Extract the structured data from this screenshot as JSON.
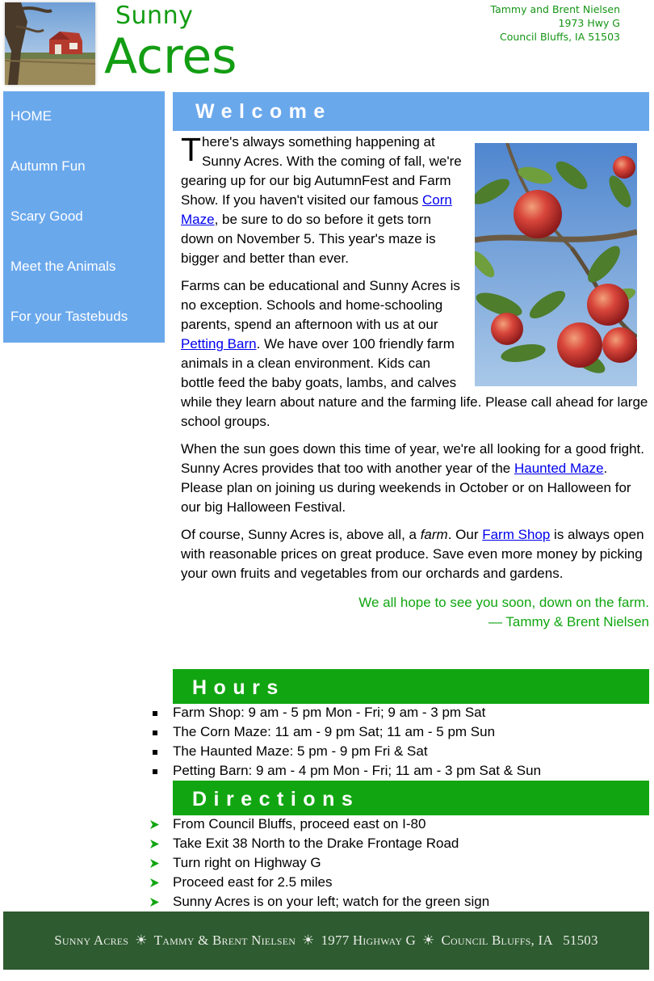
{
  "header": {
    "title_line1": "Sunny",
    "title_line2": "Acres",
    "address": [
      "Tammy and Brent Nielsen",
      "1973 Hwy G",
      "Council Bluffs, IA  51503"
    ]
  },
  "nav": [
    {
      "label": "HOME"
    },
    {
      "label": "Autumn Fun"
    },
    {
      "label": "Scary Good"
    },
    {
      "label": "Meet the Animals"
    },
    {
      "label": "For your Tastebuds"
    }
  ],
  "welcome": {
    "heading": "Welcome",
    "p1": {
      "dropcap": "T",
      "before": "here's always something happening at Sunny Acres. With the coming of fall, we're gearing up for our big AutumnFest and Farm Show. If you haven't visited our famous ",
      "link": "Corn Maze",
      "after": ", be sure to do so before it gets torn down on November 5. This year's maze is bigger and better than ever."
    },
    "p2": {
      "before": "Farms can be educational and Sunny Acres is no exception. Schools and home-schooling parents, spend an afternoon with us at our ",
      "link": "Petting Barn",
      "after": ". We have over 100 friendly farm animals in a clean environment. Kids can bottle feed the baby goats, lambs, and calves while they learn about nature and the farming life. Please call ahead for large school groups."
    },
    "p3": {
      "before": "When the sun goes down this time of year, we're all looking for a good fright. Sunny Acres provides that too with another year of the ",
      "link": "Haunted Maze",
      "after": ". Please plan on joining us during weekends in October or on Halloween for our big Halloween Festival."
    },
    "p4": {
      "before": "Of course, Sunny Acres is, above all, a ",
      "emph": "farm",
      "middle": ". Our ",
      "link": "Farm Shop",
      "after": " is always open with reasonable prices on great produce. Save even more money by picking your own fruits and vegetables from our orchards and gardens."
    },
    "signoff_line1": "We all hope to see you soon, down on the farm.",
    "signoff_line2": "— Tammy & Brent Nielsen"
  },
  "hours": {
    "heading": "Hours",
    "items": [
      "Farm Shop: 9 am - 5 pm Mon - Fri; 9 am - 3 pm Sat",
      "The Corn Maze: 11 am - 9 pm Sat; 11 am - 5 pm Sun",
      "The Haunted Maze: 5 pm - 9 pm Fri & Sat",
      "Petting Barn: 9 am - 4 pm Mon - Fri; 11 am - 3 pm Sat & Sun"
    ]
  },
  "directions": {
    "heading": "Directions",
    "items": [
      "From Council Bluffs, proceed east on I-80",
      "Take Exit 38 North to the Drake Frontage Road",
      "Turn right on Highway G",
      "Proceed east for 2.5 miles",
      "Sunny Acres is on your left; watch for the green sign"
    ]
  },
  "footer": {
    "parts": [
      "Sunny Acres",
      "Tammy & Brent Nielsen",
      "1977 Highway G",
      "Council Bluffs, IA   51503"
    ],
    "separator": "☀"
  },
  "colors": {
    "title_green": "#139d13",
    "nav_blue": "#6aa8ec",
    "band_green": "#11a611",
    "footer_green": "#2e5b30",
    "link_blue": "#0000ee"
  },
  "icons": {
    "hours_bullet": "square-bullet-icon",
    "directions_bullet": "green-arrow-icon",
    "footer_separator": "sun-icon"
  }
}
